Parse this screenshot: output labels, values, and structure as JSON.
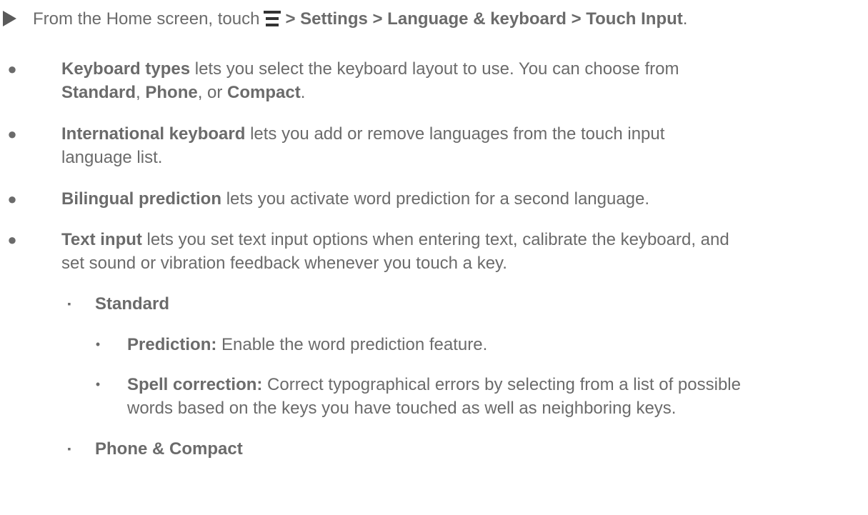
{
  "step": {
    "marker_icon": "play-triangle-icon",
    "prefix": "From the Home screen, touch",
    "menu_icon": "menu-icon",
    "path": "> Settings > Language & keyboard > Touch Input",
    "end": "."
  },
  "bullets": [
    {
      "term": "Keyboard types",
      "text_lines": [
        "lets you select the keyboard layout to use. You can choose from"
      ],
      "options": [
        "Standard",
        "Phone",
        "Compact"
      ],
      "opt_sep1": ", ",
      "opt_sep2": ", or ",
      "opt_end": "."
    },
    {
      "term": "International keyboard",
      "text_a": "lets you add or remove languages from the touch input",
      "text_b": "language list."
    },
    {
      "term": "Bilingual prediction",
      "text_a": "lets you activate word prediction for a second language."
    },
    {
      "term": "Text input",
      "text_a": "lets you set text input options when entering text, calibrate the keyboard, and",
      "text_b": "set sound or vibration feedback whenever you touch a key."
    }
  ],
  "sub": [
    {
      "label": "Standard",
      "items": [
        {
          "term": "Prediction:",
          "text_a": "Enable the word prediction feature."
        },
        {
          "term": "Spell correction:",
          "text_a": "Correct typographical errors by selecting from a list of possible",
          "text_b": "words based on the keys you have touched as well as neighboring keys."
        }
      ]
    },
    {
      "label": "Phone & Compact"
    }
  ],
  "markers": {
    "bullet": "●",
    "square": "▪",
    "dot": "•"
  }
}
